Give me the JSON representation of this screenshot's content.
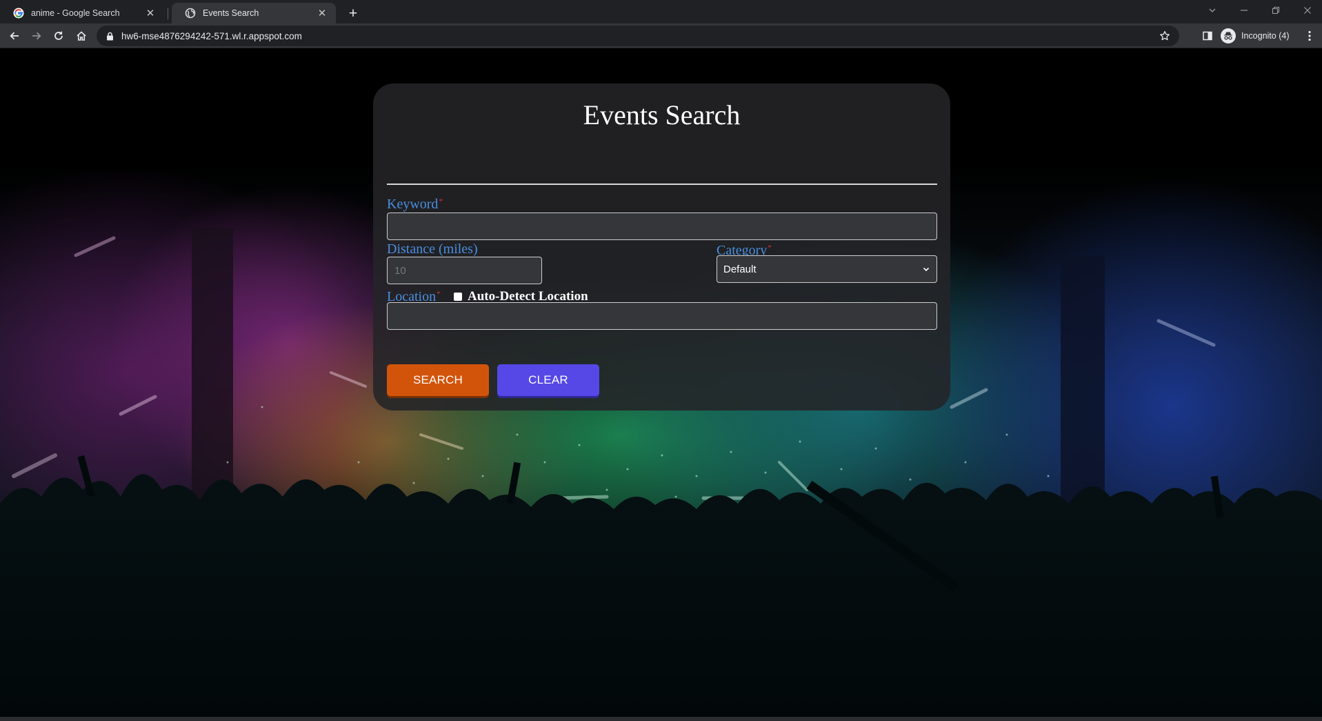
{
  "browser": {
    "tabs": [
      {
        "title": "anime - Google Search",
        "icon": "google-icon",
        "active": false
      },
      {
        "title": "Events Search",
        "icon": "globe-icon",
        "active": true
      }
    ],
    "url": "hw6-mse4876294242-571.wl.r.appspot.com",
    "profile_label": "Incognito (4)"
  },
  "form": {
    "title": "Events Search",
    "keyword": {
      "label": "Keyword",
      "required_mark": "*",
      "value": ""
    },
    "distance": {
      "label": "Distance (miles)",
      "value": "",
      "placeholder": "10"
    },
    "category": {
      "label": "Category",
      "required_mark": "*",
      "selected": "Default"
    },
    "location": {
      "label": "Location",
      "required_mark": "*",
      "value": ""
    },
    "auto_detect": {
      "label": "Auto-Detect Location",
      "checked": false
    },
    "search_button": "SEARCH",
    "clear_button": "CLEAR"
  },
  "colors": {
    "label_blue": "#4a8fe0",
    "required_red": "#e0302f",
    "search_button": "#d2540b",
    "clear_button": "#5548e6",
    "card_bg": "#242428"
  }
}
